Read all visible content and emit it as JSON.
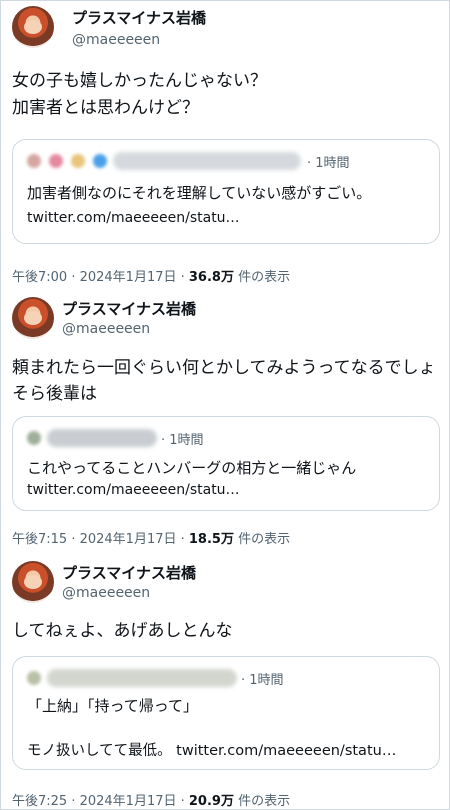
{
  "user": {
    "name": "プラスマイナス岩橋",
    "handle": "@maeeeeen"
  },
  "tweets": [
    {
      "body": [
        "女の子も嬉しかったんじゃない？",
        "加害者とは思わんけど？"
      ],
      "quote": {
        "time": "· 1時間",
        "lines": [
          "加害者側なのにそれを理解していない感がすごい。"
        ],
        "link": "twitter.com/maeeeeen/statu…"
      },
      "meta": {
        "time": "午後7:00 · 2024年1月17日 · ",
        "views": "36.8万",
        "suffix": " 件の表示"
      }
    },
    {
      "body": [
        "頼まれたら一回ぐらい何とかしてみようってなるでしょ",
        "そら後輩は"
      ],
      "quote": {
        "time": "· 1時間",
        "lines": [
          "これやってることハンバーグの相方と一緒じゃん"
        ],
        "link": "twitter.com/maeeeeen/statu…"
      },
      "meta": {
        "time": "午後7:15 · 2024年1月17日 · ",
        "views": "18.5万",
        "suffix": " 件の表示"
      }
    },
    {
      "body": [
        "してねぇよ、あげあしとんな"
      ],
      "quote": {
        "time": "· 1時間",
        "lines": [
          "「上納」「持って帰って」",
          "モノ扱いしてて最低。 twitter.com/maeeeeen/statu…"
        ],
        "link": ""
      },
      "meta": {
        "time": "午後7:25 · 2024年1月17日 · ",
        "views": "20.9万",
        "suffix": " 件の表示"
      }
    }
  ]
}
